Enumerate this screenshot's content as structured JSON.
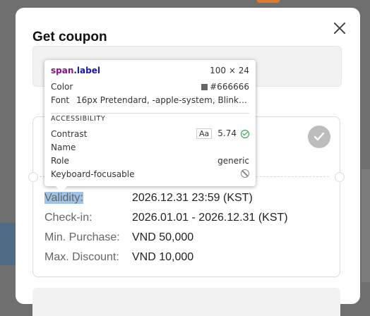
{
  "modal": {
    "title": "Get coupon"
  },
  "coupon": {
    "details": [
      {
        "label": "Validity:",
        "value": "2026.12.31 23:59 (KST)"
      },
      {
        "label": "Check-in:",
        "value": "2026.01.01 - 2026.12.31 (KST)"
      },
      {
        "label": "Min. Purchase:",
        "value": "VND 50,000"
      },
      {
        "label": "Max. Discount:",
        "value": "VND 10,000"
      }
    ]
  },
  "inspector": {
    "tag": "span",
    "class": ".label",
    "dimensions": "100 × 24",
    "color_label": "Color",
    "color_value": "#666666",
    "font_label": "Font",
    "font_value": "16px Pretendard, -apple-system, BlinkMa...",
    "accessibility_header": "ACCESSIBILITY",
    "contrast_label": "Contrast",
    "contrast_aa": "Aa",
    "contrast_value": "5.74",
    "name_label": "Name",
    "role_label": "Role",
    "role_value": "generic",
    "focusable_label": "Keyboard-focusable"
  },
  "colors": {
    "highlight": "#9fc3e6",
    "label_text": "#666666",
    "check_circle": "#bdbdbd"
  }
}
